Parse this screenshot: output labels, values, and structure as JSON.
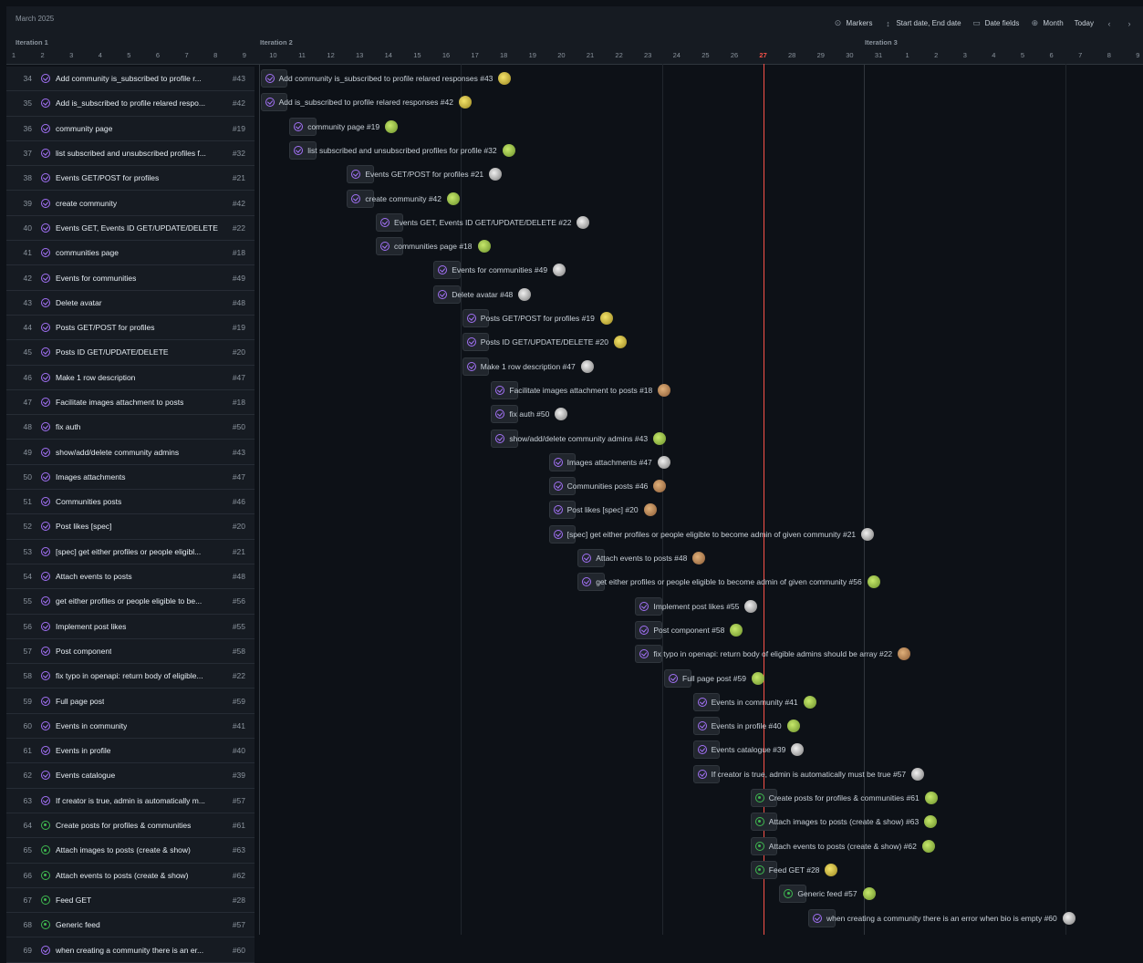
{
  "header": {
    "month": "March 2025",
    "iterations": [
      "Iteration 1",
      "Iteration 2",
      "Iteration 3"
    ],
    "toolbar": {
      "markers": "Markers",
      "dates": "Start date, End date",
      "date_fields": "Date fields",
      "zoom": "Month",
      "today": "Today"
    },
    "days": [
      "1",
      "2",
      "3",
      "4",
      "5",
      "6",
      "7",
      "8",
      "9",
      "10",
      "11",
      "12",
      "13",
      "14",
      "15",
      "16",
      "17",
      "18",
      "19",
      "20",
      "21",
      "22",
      "23",
      "24",
      "25",
      "26",
      "27",
      "28",
      "29",
      "30",
      "31",
      "1",
      "2",
      "3",
      "4",
      "5",
      "6",
      "7",
      "8",
      "9"
    ],
    "today_label": "27"
  },
  "rows": [
    {
      "num": "34",
      "title": "Add community is_subscribed to profile r...",
      "issue": "#43",
      "bar": "Add community is_subscribed to profile relared responses #43",
      "status": "closed",
      "start": 10,
      "avatar": "y"
    },
    {
      "num": "35",
      "title": "Add is_subscribed to profile relared respo...",
      "issue": "#42",
      "bar": "Add is_subscribed to profile relared responses #42",
      "status": "closed",
      "start": 10,
      "avatar": "y"
    },
    {
      "num": "36",
      "title": "community page",
      "issue": "#19",
      "bar": "community page #19",
      "status": "closed",
      "start": 11,
      "avatar": "g"
    },
    {
      "num": "37",
      "title": "list subscribed and unsubscribed profiles f...",
      "issue": "#32",
      "bar": "list subscribed and unsubscribed profiles for profile #32",
      "status": "closed",
      "start": 11,
      "avatar": "g"
    },
    {
      "num": "38",
      "title": "Events GET/POST for profiles",
      "issue": "#21",
      "bar": "Events GET/POST for profiles #21",
      "status": "closed",
      "start": 13,
      "avatar": "w"
    },
    {
      "num": "39",
      "title": "create community",
      "issue": "#42",
      "bar": "create community #42",
      "status": "closed",
      "start": 13,
      "avatar": "g"
    },
    {
      "num": "40",
      "title": "Events GET, Events ID GET/UPDATE/DELETE",
      "issue": "#22",
      "bar": "Events GET, Events ID GET/UPDATE/DELETE #22",
      "status": "closed",
      "start": 14,
      "avatar": "w"
    },
    {
      "num": "41",
      "title": "communities page",
      "issue": "#18",
      "bar": "communities page #18",
      "status": "closed",
      "start": 14,
      "avatar": "g"
    },
    {
      "num": "42",
      "title": "Events for communities",
      "issue": "#49",
      "bar": "Events for communities #49",
      "status": "closed",
      "start": 16,
      "avatar": "w"
    },
    {
      "num": "43",
      "title": "Delete avatar",
      "issue": "#48",
      "bar": "Delete avatar #48",
      "status": "closed",
      "start": 16,
      "avatar": "w"
    },
    {
      "num": "44",
      "title": "Posts GET/POST for profiles",
      "issue": "#19",
      "bar": "Posts GET/POST for profiles #19",
      "status": "closed",
      "start": 17,
      "avatar": "y"
    },
    {
      "num": "45",
      "title": "Posts ID GET/UPDATE/DELETE",
      "issue": "#20",
      "bar": "Posts ID GET/UPDATE/DELETE #20",
      "status": "closed",
      "start": 17,
      "avatar": "y"
    },
    {
      "num": "46",
      "title": "Make 1 row description",
      "issue": "#47",
      "bar": "Make 1 row description #47",
      "status": "closed",
      "start": 17,
      "avatar": "w"
    },
    {
      "num": "47",
      "title": "Facilitate images attachment to posts",
      "issue": "#18",
      "bar": "Facilitate images attachment to posts #18",
      "status": "closed",
      "start": 18,
      "avatar": ""
    },
    {
      "num": "48",
      "title": "fix auth",
      "issue": "#50",
      "bar": "fix auth #50",
      "status": "closed",
      "start": 18,
      "avatar": "w"
    },
    {
      "num": "49",
      "title": "show/add/delete community admins",
      "issue": "#43",
      "bar": "show/add/delete community admins #43",
      "status": "closed",
      "start": 18,
      "avatar": "g"
    },
    {
      "num": "50",
      "title": "Images attachments",
      "issue": "#47",
      "bar": "Images attachments #47",
      "status": "closed",
      "start": 20,
      "avatar": "w"
    },
    {
      "num": "51",
      "title": "Communities posts",
      "issue": "#46",
      "bar": "Communities posts #46",
      "status": "closed",
      "start": 20,
      "avatar": ""
    },
    {
      "num": "52",
      "title": "Post likes [spec]",
      "issue": "#20",
      "bar": "Post likes [spec] #20",
      "status": "closed",
      "start": 20,
      "avatar": ""
    },
    {
      "num": "53",
      "title": "[spec] get either profiles or people eligibl...",
      "issue": "#21",
      "bar": "[spec] get either profiles or people eligible to become admin of given community #21",
      "status": "closed",
      "start": 20,
      "avatar": "w"
    },
    {
      "num": "54",
      "title": "Attach events to posts",
      "issue": "#48",
      "bar": "Attach events to posts #48",
      "status": "closed",
      "start": 21,
      "avatar": ""
    },
    {
      "num": "55",
      "title": "get either profiles or people eligible to be...",
      "issue": "#56",
      "bar": "get either profiles or people eligible to become admin of given community #56",
      "status": "closed",
      "start": 21,
      "avatar": "g"
    },
    {
      "num": "56",
      "title": "Implement post likes",
      "issue": "#55",
      "bar": "Implement post likes #55",
      "status": "closed",
      "start": 23,
      "avatar": "w"
    },
    {
      "num": "57",
      "title": "Post component",
      "issue": "#58",
      "bar": "Post component #58",
      "status": "closed",
      "start": 23,
      "avatar": "g"
    },
    {
      "num": "58",
      "title": "fix typo in openapi: return body of eligible...",
      "issue": "#22",
      "bar": "fix typo in openapi: return body of eligible admins should be array #22",
      "status": "closed",
      "start": 23,
      "avatar": ""
    },
    {
      "num": "59",
      "title": "Full page post",
      "issue": "#59",
      "bar": "Full page post #59",
      "status": "closed",
      "start": 24,
      "avatar": "g"
    },
    {
      "num": "60",
      "title": "Events in community",
      "issue": "#41",
      "bar": "Events in community #41",
      "status": "closed",
      "start": 25,
      "avatar": "g"
    },
    {
      "num": "61",
      "title": "Events in profile",
      "issue": "#40",
      "bar": "Events in profile #40",
      "status": "closed",
      "start": 25,
      "avatar": "g"
    },
    {
      "num": "62",
      "title": "Events catalogue",
      "issue": "#39",
      "bar": "Events catalogue #39",
      "status": "closed",
      "start": 25,
      "avatar": "w"
    },
    {
      "num": "63",
      "title": "If creator is true, admin is automatically m...",
      "issue": "#57",
      "bar": "If creator is true, admin is automatically must be true #57",
      "status": "closed",
      "start": 25,
      "avatar": "w"
    },
    {
      "num": "64",
      "title": "Create posts for profiles & communities",
      "issue": "#61",
      "bar": "Create posts for profiles & communities #61",
      "status": "open",
      "start": 27,
      "avatar": "g"
    },
    {
      "num": "65",
      "title": "Attach images to posts (create & show)",
      "issue": "#63",
      "bar": "Attach images to posts (create & show) #63",
      "status": "open",
      "start": 27,
      "avatar": "g"
    },
    {
      "num": "66",
      "title": "Attach events to posts (create & show)",
      "issue": "#62",
      "bar": "Attach events to posts (create & show) #62",
      "status": "open",
      "start": 27,
      "avatar": "g"
    },
    {
      "num": "67",
      "title": "Feed GET",
      "issue": "#28",
      "bar": "Feed GET #28",
      "status": "open",
      "start": 27,
      "avatar": "y"
    },
    {
      "num": "68",
      "title": "Generic feed",
      "issue": "#57",
      "bar": "Generic feed #57",
      "status": "open",
      "start": 28,
      "avatar": "g"
    },
    {
      "num": "69",
      "title": "when creating a community there is an er...",
      "issue": "#60",
      "bar": "when creating a community there is an error when bio is empty #60",
      "status": "closed",
      "start": 29,
      "avatar": "w"
    }
  ]
}
